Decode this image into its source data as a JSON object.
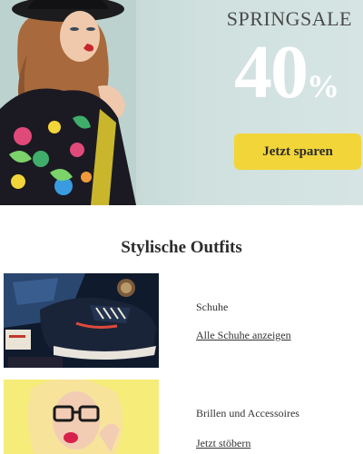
{
  "hero": {
    "title": "SPRINGSALE",
    "discount_number": "40",
    "discount_symbol": "%",
    "cta_label": "Jetzt sparen",
    "accent_color": "#f2d539"
  },
  "section": {
    "title": "Stylische Outfits"
  },
  "categories": [
    {
      "label": "Schuhe",
      "link": "Alle Schuhe anzeigen",
      "image": "sneakers-photo"
    },
    {
      "label": "Brillen und Accessoires",
      "link": "Jetzt stöbern",
      "image": "glasses-model-photo"
    }
  ]
}
